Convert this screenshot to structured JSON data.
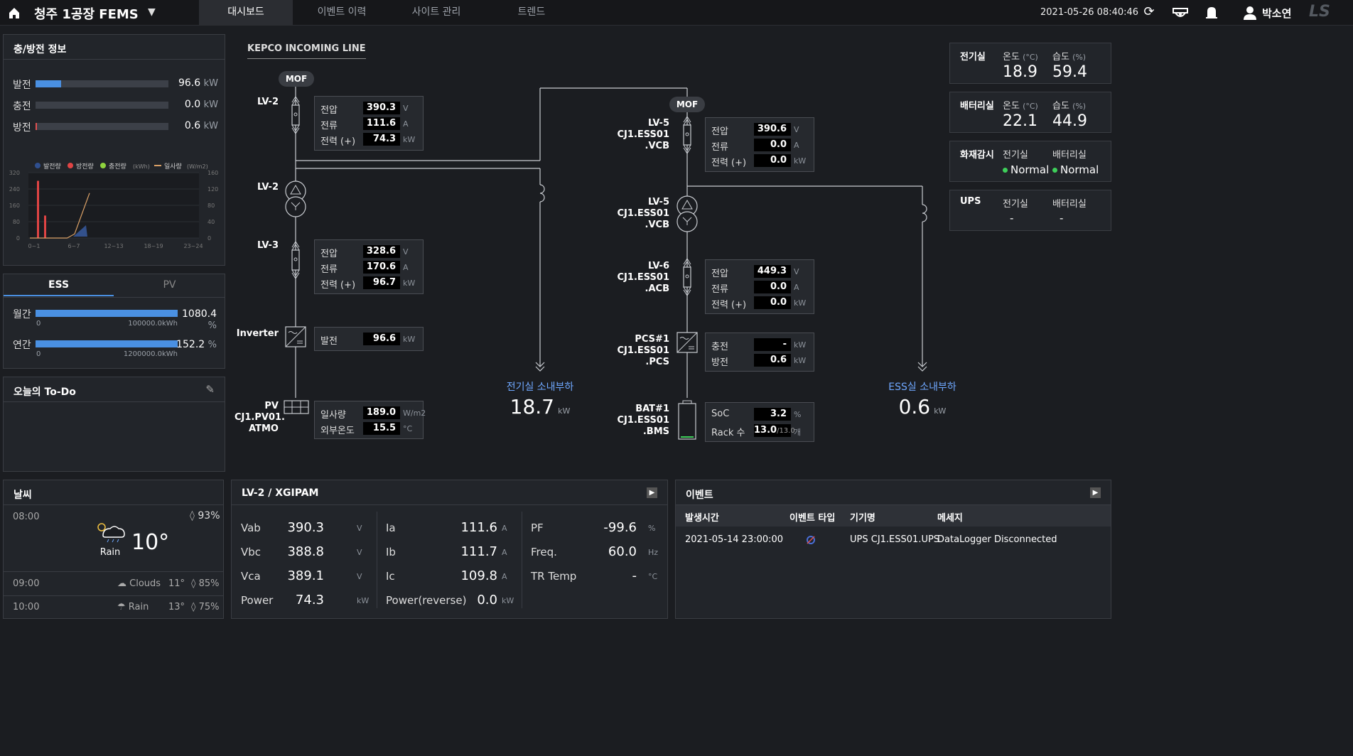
{
  "topbar": {
    "title": "청주 1공장 FEMS",
    "tabs": [
      "대시보드",
      "이벤트 이력",
      "사이트 관리",
      "트렌드"
    ],
    "datetime": "2021-05-26 08:40:46",
    "user": "박소연",
    "logo": "LS"
  },
  "charge_info": {
    "title": "충/방전 정보",
    "rows": [
      {
        "label": "발전",
        "value": "96.6",
        "unit": "kW",
        "fill": 0.19
      },
      {
        "label": "충전",
        "value": "0.0",
        "unit": "kW",
        "fill": 0
      },
      {
        "label": "방전",
        "value": "0.6",
        "unit": "kW",
        "fill": 0.01
      }
    ],
    "legend": [
      "발전량",
      "방전량",
      "충전량",
      "(kWh)",
      "일사량",
      "(W/m2)"
    ],
    "y_left_ticks": [
      "320",
      "240",
      "160",
      "80",
      "0"
    ],
    "y_right_ticks": [
      "160",
      "120",
      "80",
      "40",
      "0"
    ],
    "x_ticks": [
      "0~1",
      "6~7",
      "12~13",
      "18~19",
      "23~24"
    ]
  },
  "chart_data": {
    "type": "bar",
    "categories": [
      "0~1",
      "6~7",
      "12~13",
      "18~19",
      "23~24"
    ],
    "series": [
      {
        "name": "발전량",
        "values": []
      },
      {
        "name": "방전량",
        "values": [
          280,
          110
        ]
      },
      {
        "name": "충전량",
        "values": []
      },
      {
        "name": "일사량",
        "values": [
          0,
          0,
          0,
          0,
          0,
          0,
          10,
          60,
          110
        ]
      }
    ],
    "ylim": [
      0,
      320
    ],
    "y2lim": [
      0,
      160
    ]
  },
  "ess_pv": {
    "tabs": [
      "ESS",
      "PV"
    ],
    "rows": [
      {
        "label": "월간",
        "value": "1080.4",
        "unit": "%",
        "min": "0",
        "max": "100000.0kWh"
      },
      {
        "label": "연간",
        "value": "152.2",
        "unit": "%",
        "min": "0",
        "max": "1200000.0kWh"
      }
    ]
  },
  "todo": {
    "title": "오늘의 To-Do"
  },
  "sld": {
    "kepco_label": "KEPCO INCOMING LINE",
    "mof1": "MOF",
    "mof2": "MOF",
    "left": {
      "lv2a": "LV-2",
      "lv2b": "LV-2",
      "lv3": "LV-3",
      "inverter": "Inverter",
      "pv": [
        "PV",
        "CJ1.PV01.",
        "ATMO"
      ],
      "m1": [
        {
          "k": "전압",
          "v": "390.3",
          "u": "V"
        },
        {
          "k": "전류",
          "v": "111.6",
          "u": "A"
        },
        {
          "k": "전력 (+)",
          "v": "74.3",
          "u": "kW"
        }
      ],
      "m2": [
        {
          "k": "전압",
          "v": "328.6",
          "u": "V"
        },
        {
          "k": "전류",
          "v": "170.6",
          "u": "A"
        },
        {
          "k": "전력 (+)",
          "v": "96.7",
          "u": "kW"
        }
      ],
      "m3": [
        {
          "k": "발전",
          "v": "96.6",
          "u": "kW"
        }
      ],
      "m4": [
        {
          "k": "일사량",
          "v": "189.0",
          "u": "W/m2"
        },
        {
          "k": "외부온도",
          "v": "15.5",
          "u": "°C"
        }
      ]
    },
    "right": {
      "lv5a": [
        "LV-5",
        "CJ1.ESS01",
        ".VCB"
      ],
      "lv5b": [
        "LV-5",
        "CJ1.ESS01",
        ".VCB"
      ],
      "lv6": [
        "LV-6",
        "CJ1.ESS01",
        ".ACB"
      ],
      "pcs": [
        "PCS#1",
        "CJ1.ESS01",
        ".PCS"
      ],
      "bat": [
        "BAT#1",
        "CJ1.ESS01",
        ".BMS"
      ],
      "m1": [
        {
          "k": "전압",
          "v": "390.6",
          "u": "V"
        },
        {
          "k": "전류",
          "v": "0.0",
          "u": "A"
        },
        {
          "k": "전력 (+)",
          "v": "0.0",
          "u": "kW"
        }
      ],
      "m2": [
        {
          "k": "전압",
          "v": "449.3",
          "u": "V"
        },
        {
          "k": "전류",
          "v": "0.0",
          "u": "A"
        },
        {
          "k": "전력 (+)",
          "v": "0.0",
          "u": "kW"
        }
      ],
      "m3": [
        {
          "k": "충전",
          "v": "-",
          "u": "kW"
        },
        {
          "k": "방전",
          "v": "0.6",
          "u": "kW"
        }
      ],
      "m4": [
        {
          "k": "SoC",
          "v": "3.2",
          "u": "%"
        },
        {
          "k": "Rack 수",
          "v": "13.0",
          "v2": "/13.0",
          "u": "개"
        }
      ]
    },
    "load1": {
      "label": "전기실 소내부하",
      "value": "18.7",
      "unit": "kW"
    },
    "load2": {
      "label": "ESS실 소내부하",
      "value": "0.6",
      "unit": "kW"
    }
  },
  "rooms": {
    "elec": {
      "title": "전기실",
      "temp_label": "온도",
      "temp_unit": "(°C)",
      "hum_label": "습도",
      "hum_unit": "(%)",
      "temp": "18.9",
      "hum": "59.4"
    },
    "bat": {
      "title": "배터리실",
      "temp_label": "온도",
      "temp_unit": "(°C)",
      "hum_label": "습도",
      "hum_unit": "(%)",
      "temp": "22.1",
      "hum": "44.9"
    },
    "fire": {
      "title": "화재감시",
      "a_label": "전기실",
      "b_label": "배터리실",
      "a": "Normal",
      "b": "Normal"
    },
    "ups": {
      "title": "UPS",
      "a_label": "전기실",
      "b_label": "배터리실",
      "a": "-",
      "b": "-"
    }
  },
  "weather": {
    "title": "날씨",
    "now": {
      "time": "08:00",
      "humidity": "93%",
      "cond": "Rain",
      "temp": "10°"
    },
    "rows": [
      {
        "time": "09:00",
        "cond": "Clouds",
        "temp": "11°",
        "humidity": "85%"
      },
      {
        "time": "10:00",
        "cond": "Rain",
        "temp": "13°",
        "humidity": "75%"
      }
    ]
  },
  "power_meter": {
    "title": "LV-2 / XGIPAM",
    "col1": [
      {
        "k": "Vab",
        "v": "390.3",
        "u": "V"
      },
      {
        "k": "Vbc",
        "v": "388.8",
        "u": "V"
      },
      {
        "k": "Vca",
        "v": "389.1",
        "u": "V"
      },
      {
        "k": "Power",
        "v": "74.3",
        "u": "kW"
      }
    ],
    "col2": [
      {
        "k": "Ia",
        "v": "111.6",
        "u": "A"
      },
      {
        "k": "Ib",
        "v": "111.7",
        "u": "A"
      },
      {
        "k": "Ic",
        "v": "109.8",
        "u": "A"
      },
      {
        "k": "Power(reverse)",
        "v": "0.0",
        "u": "kW"
      }
    ],
    "col3": [
      {
        "k": "PF",
        "v": "-99.6",
        "u": "%"
      },
      {
        "k": "Freq.",
        "v": "60.0",
        "u": "Hz"
      },
      {
        "k": "TR Temp",
        "v": "-",
        "u": "°C"
      }
    ]
  },
  "events": {
    "title": "이벤트",
    "headers": [
      "발생시간",
      "이벤트 타입",
      "기기명",
      "메세지"
    ],
    "rows": [
      {
        "time": "2021-05-14 23:00:00",
        "device": "UPS CJ1.ESS01.UPS",
        "message": "DataLogger Disconnected"
      }
    ]
  }
}
